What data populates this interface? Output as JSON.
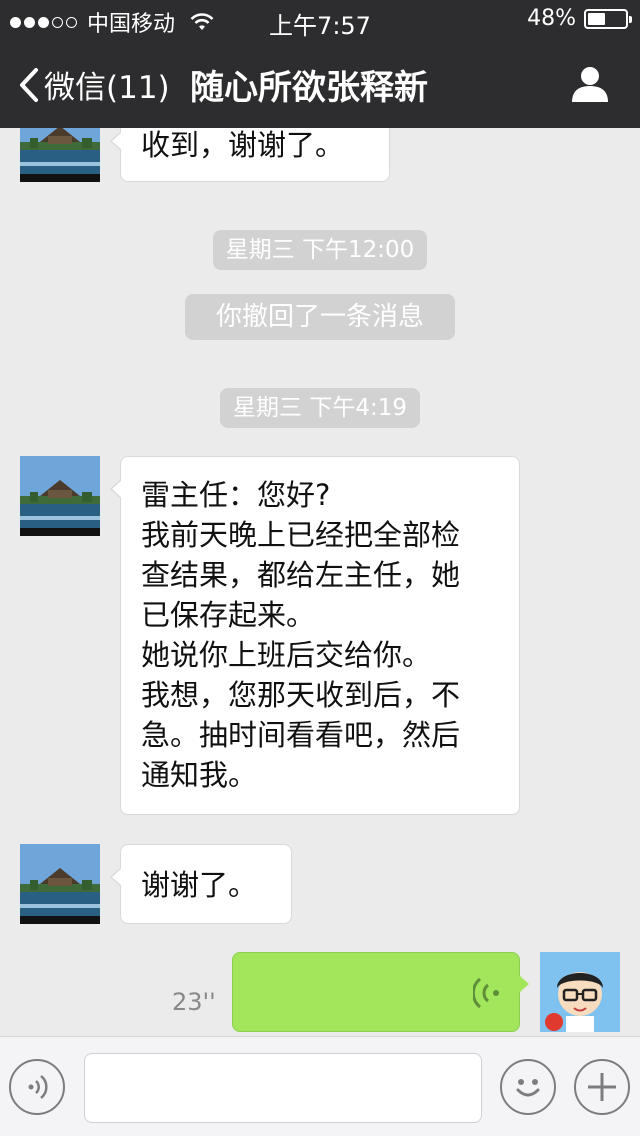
{
  "status_bar": {
    "carrier": "中国移动",
    "time": "上午7:57",
    "battery_percent": "48%",
    "battery_level": 0.48,
    "signal_bars": 3,
    "signal_total": 5
  },
  "nav": {
    "back_label": "微信(11)",
    "title": "随心所欲张释新",
    "back_icon": "chevron-left-icon",
    "profile_icon": "person-icon"
  },
  "messages": [
    {
      "type": "text",
      "side": "left",
      "lines": [
        "收到，谢谢了。"
      ]
    },
    {
      "type": "timestamp",
      "text": "星期三 下午12:00"
    },
    {
      "type": "system",
      "text": "你撤回了一条消息"
    },
    {
      "type": "timestamp",
      "text": "星期三 下午4:19"
    },
    {
      "type": "text",
      "side": "left",
      "lines": [
        "雷主任：您好?",
        "我前天晚上已经把全部检",
        "查结果，都给左主任，她",
        "已保存起来。",
        "她说你上班后交给你。",
        "我想，您那天收到后，不",
        "急。抽时间看看吧，然后",
        "通知我。"
      ]
    },
    {
      "type": "text",
      "side": "left",
      "lines": [
        "谢谢了。"
      ]
    },
    {
      "type": "voice",
      "side": "right",
      "duration": "23''"
    }
  ],
  "input_bar": {
    "voice_icon": "voice-mode-icon",
    "emoji_icon": "emoji-icon",
    "plus_icon": "plus-icon",
    "input_value": ""
  },
  "colors": {
    "nav_bg": "#2d2d2f",
    "chat_bg": "#ebebeb",
    "bubble_white": "#ffffff",
    "bubble_green": "#a2e65b",
    "stamp_bg": "#d2d2d2"
  }
}
